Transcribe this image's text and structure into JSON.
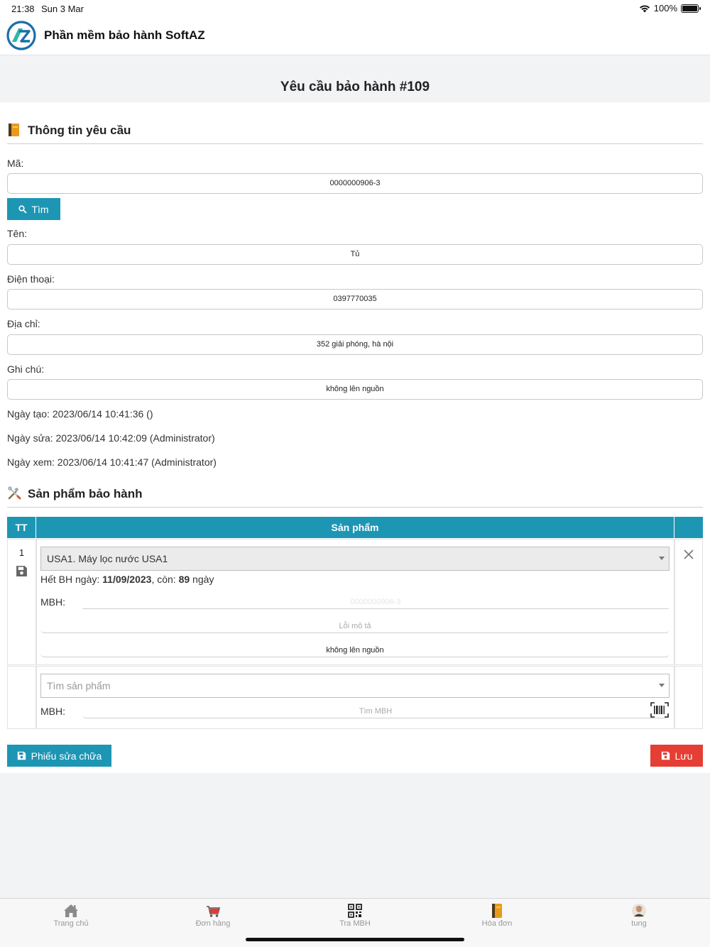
{
  "status_bar": {
    "time": "21:38",
    "date": "Sun 3 Mar",
    "battery": "100%"
  },
  "header": {
    "app_title": "Phần mềm bảo hành SoftAZ"
  },
  "page": {
    "title": "Yêu cầu bảo hành #109"
  },
  "request_info": {
    "section_title": "Thông tin yêu cầu",
    "code_label": "Mã:",
    "code_value": "0000000906-3",
    "find_button": "Tìm",
    "name_label": "Tên:",
    "name_value": "Tủ",
    "phone_label": "Điện thoại:",
    "phone_value": "0397770035",
    "address_label": "Địa chỉ:",
    "address_value": "352 giải phóng, hà nội",
    "note_label": "Ghi chú:",
    "note_value": "không lên nguồn",
    "created": "Ngày tạo: 2023/06/14 10:41:36 ()",
    "modified": "Ngày sửa: 2023/06/14 10:42:09 (Administrator)",
    "viewed": "Ngày xem: 2023/06/14 10:41:47 (Administrator)"
  },
  "products": {
    "section_title": "Sản phẩm bảo hành",
    "col_index": "TT",
    "col_product": "Sản phẩm",
    "row": {
      "index": "1",
      "product": "USA1. Máy lọc nước USA1",
      "warranty_prefix": "Hết BH ngày: ",
      "warranty_date": "11/09/2023",
      "remaining_prefix": ", còn: ",
      "remaining_days": "89",
      "remaining_suffix": " ngày",
      "mbh_label": "MBH:",
      "mbh_value": "0000000906-3",
      "fault_placeholder": "Lỗi mô tả",
      "fault_value": "không lên nguồn"
    },
    "new_row": {
      "search_placeholder": "Tìm sản phẩm",
      "mbh_label": "MBH:",
      "mbh_placeholder": "Tìm MBH"
    }
  },
  "actions": {
    "repair_button": "Phiếu sửa chữa",
    "save_button": "Lưu"
  },
  "tabbar": {
    "tabs": [
      {
        "label": "Trang chủ",
        "icon": "home-icon"
      },
      {
        "label": "Đơn hàng",
        "icon": "cart-icon"
      },
      {
        "label": "Tra MBH",
        "icon": "qr-code-icon"
      },
      {
        "label": "Hóa đơn",
        "icon": "invoice-book-icon"
      },
      {
        "label": "tung",
        "icon": "avatar-icon"
      }
    ]
  },
  "colors": {
    "accent": "#1d96b4",
    "danger": "#e53e35",
    "band": "#f1f3f4"
  }
}
